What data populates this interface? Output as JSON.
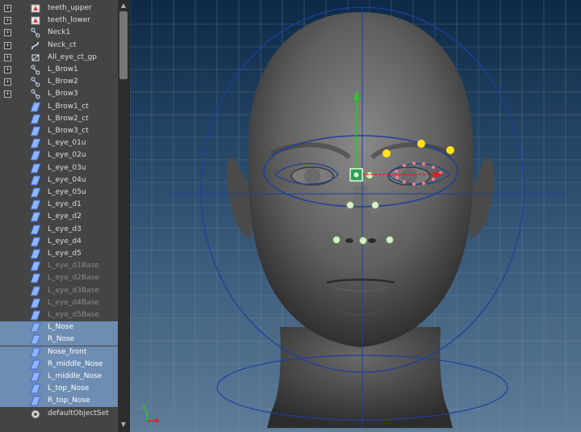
{
  "outliner": {
    "items": [
      {
        "label": "teeth_upper",
        "icon": "mesh-icon",
        "expander": true,
        "dim": false,
        "selected": false
      },
      {
        "label": "teeth_lower",
        "icon": "mesh-icon",
        "expander": true,
        "dim": false,
        "selected": false
      },
      {
        "label": "Neck1",
        "icon": "joint-icon",
        "expander": true,
        "dim": false,
        "selected": false
      },
      {
        "label": "Neck_ct",
        "icon": "curve-icon",
        "expander": true,
        "dim": false,
        "selected": false
      },
      {
        "label": "All_eye_ct_gp",
        "icon": "group-icon",
        "expander": true,
        "dim": false,
        "selected": false
      },
      {
        "label": "L_Brow1",
        "icon": "joint-icon",
        "expander": true,
        "dim": false,
        "selected": false
      },
      {
        "label": "L_Brow2",
        "icon": "joint-icon",
        "expander": true,
        "dim": false,
        "selected": false
      },
      {
        "label": "L_Brow3",
        "icon": "joint-icon",
        "expander": true,
        "dim": false,
        "selected": false
      },
      {
        "label": "L_Brow1_ct",
        "icon": "set-icon",
        "expander": false,
        "dim": false,
        "selected": false
      },
      {
        "label": "L_Brow2_ct",
        "icon": "set-icon",
        "expander": false,
        "dim": false,
        "selected": false
      },
      {
        "label": "L_Brow3_ct",
        "icon": "set-icon",
        "expander": false,
        "dim": false,
        "selected": false
      },
      {
        "label": "L_eye_01u",
        "icon": "set-icon",
        "expander": false,
        "dim": false,
        "selected": false
      },
      {
        "label": "L_eye_02u",
        "icon": "set-icon",
        "expander": false,
        "dim": false,
        "selected": false
      },
      {
        "label": "L_eye_03u",
        "icon": "set-icon",
        "expander": false,
        "dim": false,
        "selected": false
      },
      {
        "label": "L_eye_04u",
        "icon": "set-icon",
        "expander": false,
        "dim": false,
        "selected": false
      },
      {
        "label": "L_eye_05u",
        "icon": "set-icon",
        "expander": false,
        "dim": false,
        "selected": false
      },
      {
        "label": "L_eye_d1",
        "icon": "set-icon",
        "expander": false,
        "dim": false,
        "selected": false
      },
      {
        "label": "L_eye_d2",
        "icon": "set-icon",
        "expander": false,
        "dim": false,
        "selected": false
      },
      {
        "label": "L_eye_d3",
        "icon": "set-icon",
        "expander": false,
        "dim": false,
        "selected": false
      },
      {
        "label": "L_eye_d4",
        "icon": "set-icon",
        "expander": false,
        "dim": false,
        "selected": false
      },
      {
        "label": "L_eye_d5",
        "icon": "set-icon",
        "expander": false,
        "dim": false,
        "selected": false
      },
      {
        "label": "L_eye_d1Base",
        "icon": "set-icon",
        "expander": false,
        "dim": true,
        "selected": false
      },
      {
        "label": "L_eye_d2Base",
        "icon": "set-icon",
        "expander": false,
        "dim": true,
        "selected": false
      },
      {
        "label": "L_eye_d3Base",
        "icon": "set-icon",
        "expander": false,
        "dim": true,
        "selected": false
      },
      {
        "label": "L_eye_d4Base",
        "icon": "set-icon",
        "expander": false,
        "dim": true,
        "selected": false
      },
      {
        "label": "L_eye_d5Base",
        "icon": "set-icon",
        "expander": false,
        "dim": true,
        "selected": false
      },
      {
        "label": "L_Nose",
        "icon": "set-icon",
        "expander": false,
        "dim": false,
        "selected": true
      },
      {
        "label": "R_Nose",
        "icon": "set-icon",
        "expander": false,
        "dim": false,
        "selected": true
      },
      {
        "label": "Nose_front",
        "icon": "set-icon",
        "expander": false,
        "dim": false,
        "selected": true
      },
      {
        "label": "R_middle_Nose",
        "icon": "set-icon",
        "expander": false,
        "dim": false,
        "selected": true
      },
      {
        "label": "L_middle_Nose",
        "icon": "set-icon",
        "expander": false,
        "dim": false,
        "selected": true
      },
      {
        "label": "L_top_Nose",
        "icon": "set-icon",
        "expander": false,
        "dim": false,
        "selected": true
      },
      {
        "label": "R_top_Nose",
        "icon": "set-icon",
        "expander": false,
        "dim": false,
        "selected": true
      },
      {
        "label": "defaultObjectSet",
        "icon": "object-set-icon",
        "expander": false,
        "dim": false,
        "selected": false
      }
    ]
  },
  "viewport": {
    "axis_x_label": "x",
    "axis_y_label": "y",
    "colors": {
      "grid": "#7f95ab",
      "curve": "#1e3f9c",
      "brow_controls": "#ffe21a",
      "locators": "#d7f0c2",
      "manipulator_y": "#28c828",
      "manipulator_x": "#e02020",
      "selected_points": "#ff7d8d"
    }
  }
}
